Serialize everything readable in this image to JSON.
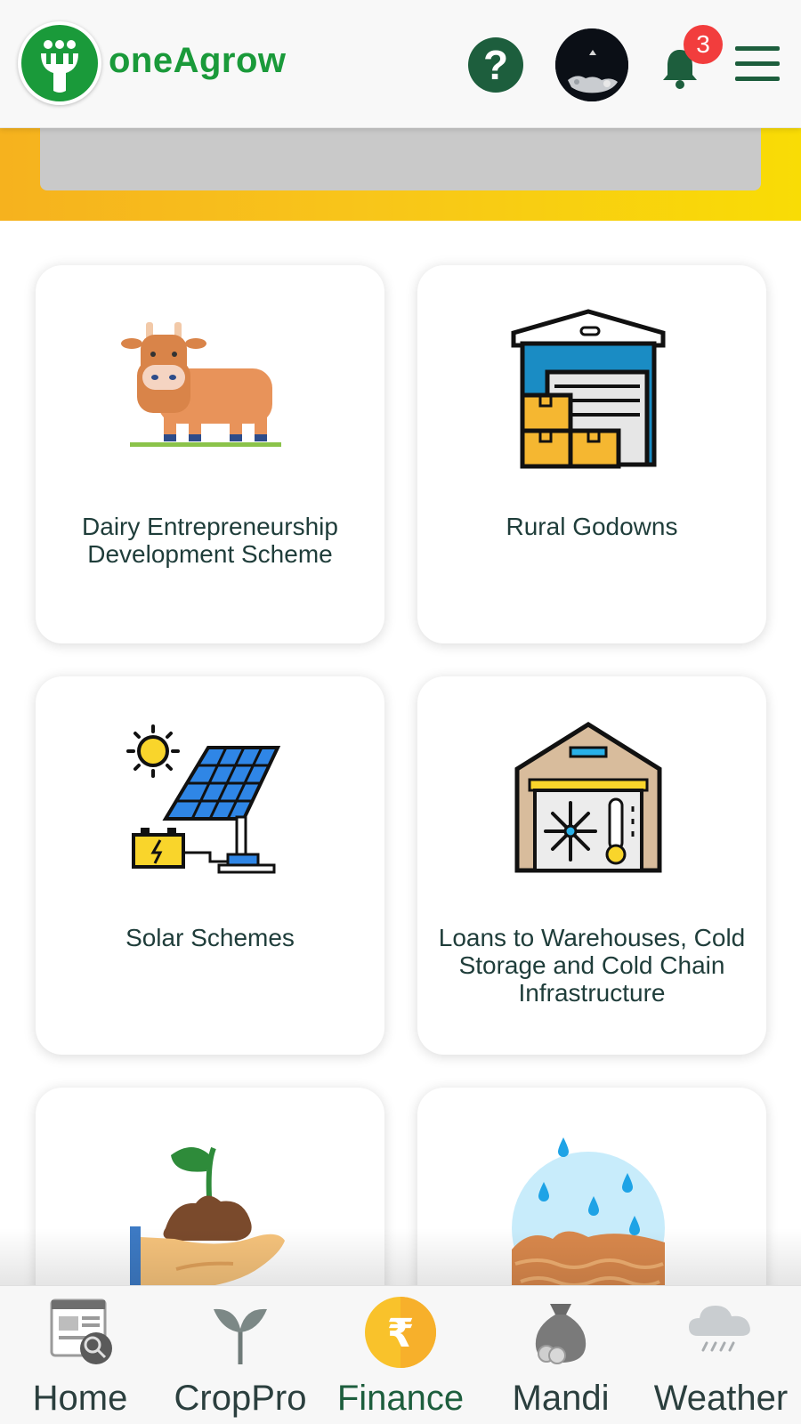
{
  "header": {
    "brand": "oneAgrow",
    "help_icon": "question-mark-icon",
    "help_symbol": "?",
    "notifications_count": "3",
    "colors": {
      "brand_green": "#1a9a3a",
      "dark_green": "#1d5e3d",
      "badge_red": "#f23d3d"
    }
  },
  "banner": {
    "gradient": [
      "#f6b21e",
      "#f9dc05"
    ]
  },
  "schemes": [
    {
      "label": "Dairy Entrepreneurship Development Scheme",
      "icon": "cow-icon"
    },
    {
      "label": "Rural Godowns",
      "icon": "warehouse-icon"
    },
    {
      "label": "Solar Schemes",
      "icon": "solar-panel-icon"
    },
    {
      "label": "Loans to Warehouses, Cold Storage and Cold Chain Infrastructure",
      "icon": "cold-storage-icon"
    },
    {
      "label": "",
      "icon": "soil-plant-hand-icon"
    },
    {
      "label": "",
      "icon": "rain-soil-icon"
    }
  ],
  "bottom_nav": {
    "items": [
      {
        "label": "Home",
        "icon": "newspaper-icon",
        "active": false
      },
      {
        "label": "CropPro",
        "icon": "sprout-icon",
        "active": false
      },
      {
        "label": "Finance",
        "icon": "rupee-icon",
        "active": true
      },
      {
        "label": "Mandi",
        "icon": "money-bag-icon",
        "active": false
      },
      {
        "label": "Weather",
        "icon": "rain-cloud-icon",
        "active": false
      }
    ],
    "rupee_symbol": "₹"
  }
}
